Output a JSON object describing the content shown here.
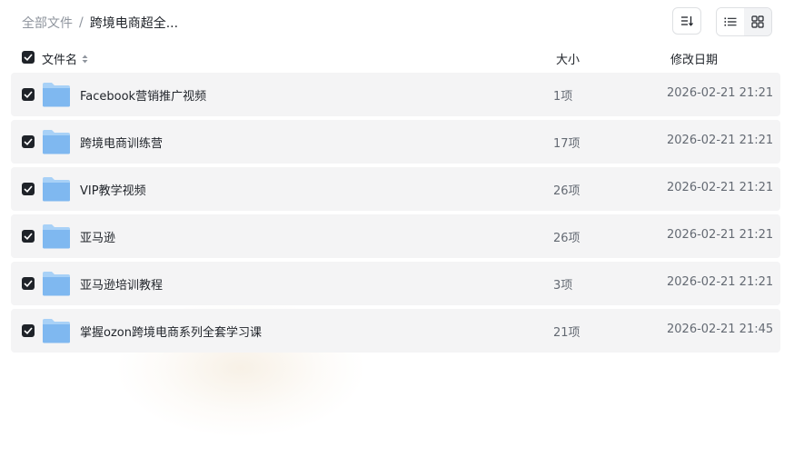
{
  "breadcrumb": {
    "root": "全部文件",
    "separator": "/",
    "current": "跨境电商超全..."
  },
  "toolbar": {
    "sort_icon": "sort-desc-icon",
    "list_view_icon": "list-view-icon",
    "grid_view_icon": "grid-view-icon",
    "active_view": "list"
  },
  "columns": {
    "name": "文件名",
    "size": "大小",
    "date": "修改日期"
  },
  "files": [
    {
      "name": "Facebook营销推广视频",
      "size": "1项",
      "date": "2026-02-21 21:21",
      "checked": true,
      "icon": "folder-icon"
    },
    {
      "name": "跨境电商训练营",
      "size": "17项",
      "date": "2026-02-21 21:21",
      "checked": true,
      "icon": "folder-icon"
    },
    {
      "name": "VIP教学视频",
      "size": "26项",
      "date": "2026-02-21 21:21",
      "checked": true,
      "icon": "folder-icon"
    },
    {
      "name": "亚马逊",
      "size": "26项",
      "date": "2026-02-21 21:21",
      "checked": true,
      "icon": "folder-icon"
    },
    {
      "name": "亚马逊培训教程",
      "size": "3项",
      "date": "2026-02-21 21:21",
      "checked": true,
      "icon": "folder-icon"
    },
    {
      "name": "掌握ozon跨境电商系列全套学习课",
      "size": "21项",
      "date": "2026-02-21 21:45",
      "checked": true,
      "icon": "folder-icon"
    }
  ],
  "colors": {
    "folder": "#7fb8f0",
    "folder_tab": "#a8d1f7",
    "row_bg": "#f4f4f5",
    "checkbox": "#1f2329"
  }
}
